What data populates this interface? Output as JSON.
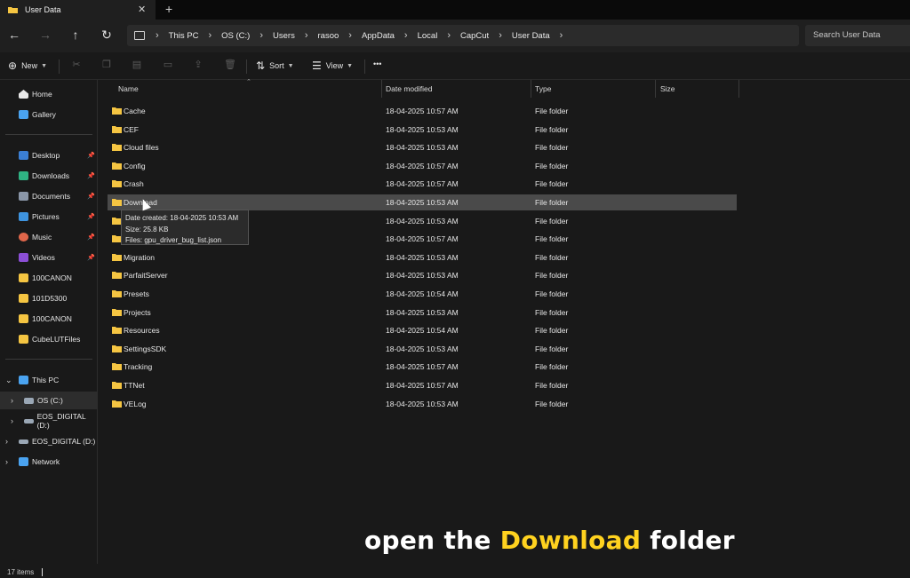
{
  "tab": {
    "title": "User Data",
    "close": "✕",
    "new_tab": "+"
  },
  "nav": {
    "back": "←",
    "forward": "→",
    "up": "↑",
    "refresh": "↻"
  },
  "breadcrumb": [
    "This PC",
    "OS (C:)",
    "Users",
    "rasoo",
    "AppData",
    "Local",
    "CapCut",
    "User Data"
  ],
  "search": {
    "placeholder": "Search User Data"
  },
  "commands": {
    "new_label": "New",
    "sort_label": "Sort",
    "view_label": "View",
    "more": "•••"
  },
  "icons": {
    "folder_color": "#f5c542",
    "accent": "#4aa3f0"
  },
  "sidebar": {
    "quick": [
      {
        "label": "Home",
        "icon": "home-icon"
      },
      {
        "label": "Gallery",
        "icon": "gallery-icon"
      }
    ],
    "pinned": [
      {
        "label": "Desktop",
        "icon": "desktop-icon",
        "pinned": true
      },
      {
        "label": "Downloads",
        "icon": "downloads-icon",
        "pinned": true
      },
      {
        "label": "Documents",
        "icon": "documents-icon",
        "pinned": true
      },
      {
        "label": "Pictures",
        "icon": "pictures-icon",
        "pinned": true
      },
      {
        "label": "Music",
        "icon": "music-icon",
        "pinned": true
      },
      {
        "label": "Videos",
        "icon": "videos-icon",
        "pinned": true
      },
      {
        "label": "100CANON",
        "icon": "folder-icon",
        "pinned": false
      },
      {
        "label": "101D5300",
        "icon": "folder-icon",
        "pinned": false
      },
      {
        "label": "100CANON",
        "icon": "folder-icon",
        "pinned": false
      },
      {
        "label": "CubeLUTFiles",
        "icon": "folder-icon",
        "pinned": false
      }
    ],
    "tree": [
      {
        "label": "This PC",
        "icon": "pc-icon"
      },
      {
        "label": "OS (C:)",
        "icon": "drive-icon"
      },
      {
        "label": "EOS_DIGITAL (D:)",
        "icon": "drive-icon"
      },
      {
        "label": "EOS_DIGITAL (D:)",
        "icon": "drive-icon"
      },
      {
        "label": "Network",
        "icon": "network-icon"
      }
    ]
  },
  "columns": {
    "name": "Name",
    "date": "Date modified",
    "type": "Type",
    "size": "Size"
  },
  "files": [
    {
      "name": "Cache",
      "date": "18-04-2025 10:57 AM",
      "type": "File folder"
    },
    {
      "name": "CEF",
      "date": "18-04-2025 10:53 AM",
      "type": "File folder"
    },
    {
      "name": "Cloud files",
      "date": "18-04-2025 10:53 AM",
      "type": "File folder"
    },
    {
      "name": "Config",
      "date": "18-04-2025 10:57 AM",
      "type": "File folder"
    },
    {
      "name": "Crash",
      "date": "18-04-2025 10:57 AM",
      "type": "File folder"
    },
    {
      "name": "Download",
      "date": "18-04-2025 10:53 AM",
      "type": "File folder"
    },
    {
      "name": "",
      "date": "18-04-2025 10:53 AM",
      "type": "File folder"
    },
    {
      "name": "",
      "date": "18-04-2025 10:57 AM",
      "type": "File folder"
    },
    {
      "name": "Migration",
      "date": "18-04-2025 10:53 AM",
      "type": "File folder"
    },
    {
      "name": "ParfaitServer",
      "date": "18-04-2025 10:53 AM",
      "type": "File folder"
    },
    {
      "name": "Presets",
      "date": "18-04-2025 10:54 AM",
      "type": "File folder"
    },
    {
      "name": "Projects",
      "date": "18-04-2025 10:53 AM",
      "type": "File folder"
    },
    {
      "name": "Resources",
      "date": "18-04-2025 10:54 AM",
      "type": "File folder"
    },
    {
      "name": "SettingsSDK",
      "date": "18-04-2025 10:53 AM",
      "type": "File folder"
    },
    {
      "name": "Tracking",
      "date": "18-04-2025 10:57 AM",
      "type": "File folder"
    },
    {
      "name": "TTNet",
      "date": "18-04-2025 10:57 AM",
      "type": "File folder"
    },
    {
      "name": "VELog",
      "date": "18-04-2025 10:53 AM",
      "type": "File folder"
    }
  ],
  "tooltip": {
    "line1": "Date created: 18-04-2025 10:53 AM",
    "line2": "Size: 25.8 KB",
    "line3": "Files: gpu_driver_bug_list.json"
  },
  "status": {
    "items": "17 items"
  },
  "caption": {
    "pre": "open the",
    "highlight": "Download",
    "post": "folder"
  }
}
